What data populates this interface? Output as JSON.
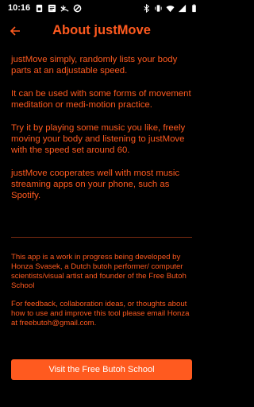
{
  "status_bar": {
    "time": "10:16",
    "left_icons": [
      "sim-icon",
      "note-icon",
      "missed-call-icon",
      "blocked-icon"
    ],
    "right_icons": [
      "bluetooth-icon",
      "vibrate-icon",
      "wifi-icon",
      "signal-icon",
      "battery-icon"
    ]
  },
  "header": {
    "title": "About justMove",
    "back_icon": "back-arrow-icon"
  },
  "about": {
    "paragraphs": [
      "justMove simply, randomly lists your body parts at an adjustable speed.",
      "It can be used with some forms of movement meditation or medi-motion practice.",
      "Try it by playing some music you like, freely moving your body and listening to justMove with the speed set around 60.",
      "justMove cooperates well with most music streaming apps on your phone, such as Spotify."
    ]
  },
  "info": {
    "paragraphs": [
      "This app is a work in progress being developed by Honza Svasek, a Dutch butoh performer/ computer scientists/visual artist and founder of the Free Butoh School",
      "For feedback, collaboration ideas, or thoughts about how to use and improve this tool please email Honza at freebutoh@gmail.com."
    ]
  },
  "button": {
    "label": "Visit the Free Butoh School"
  },
  "colors": {
    "accent": "#ff5a1f",
    "background": "#000000"
  }
}
